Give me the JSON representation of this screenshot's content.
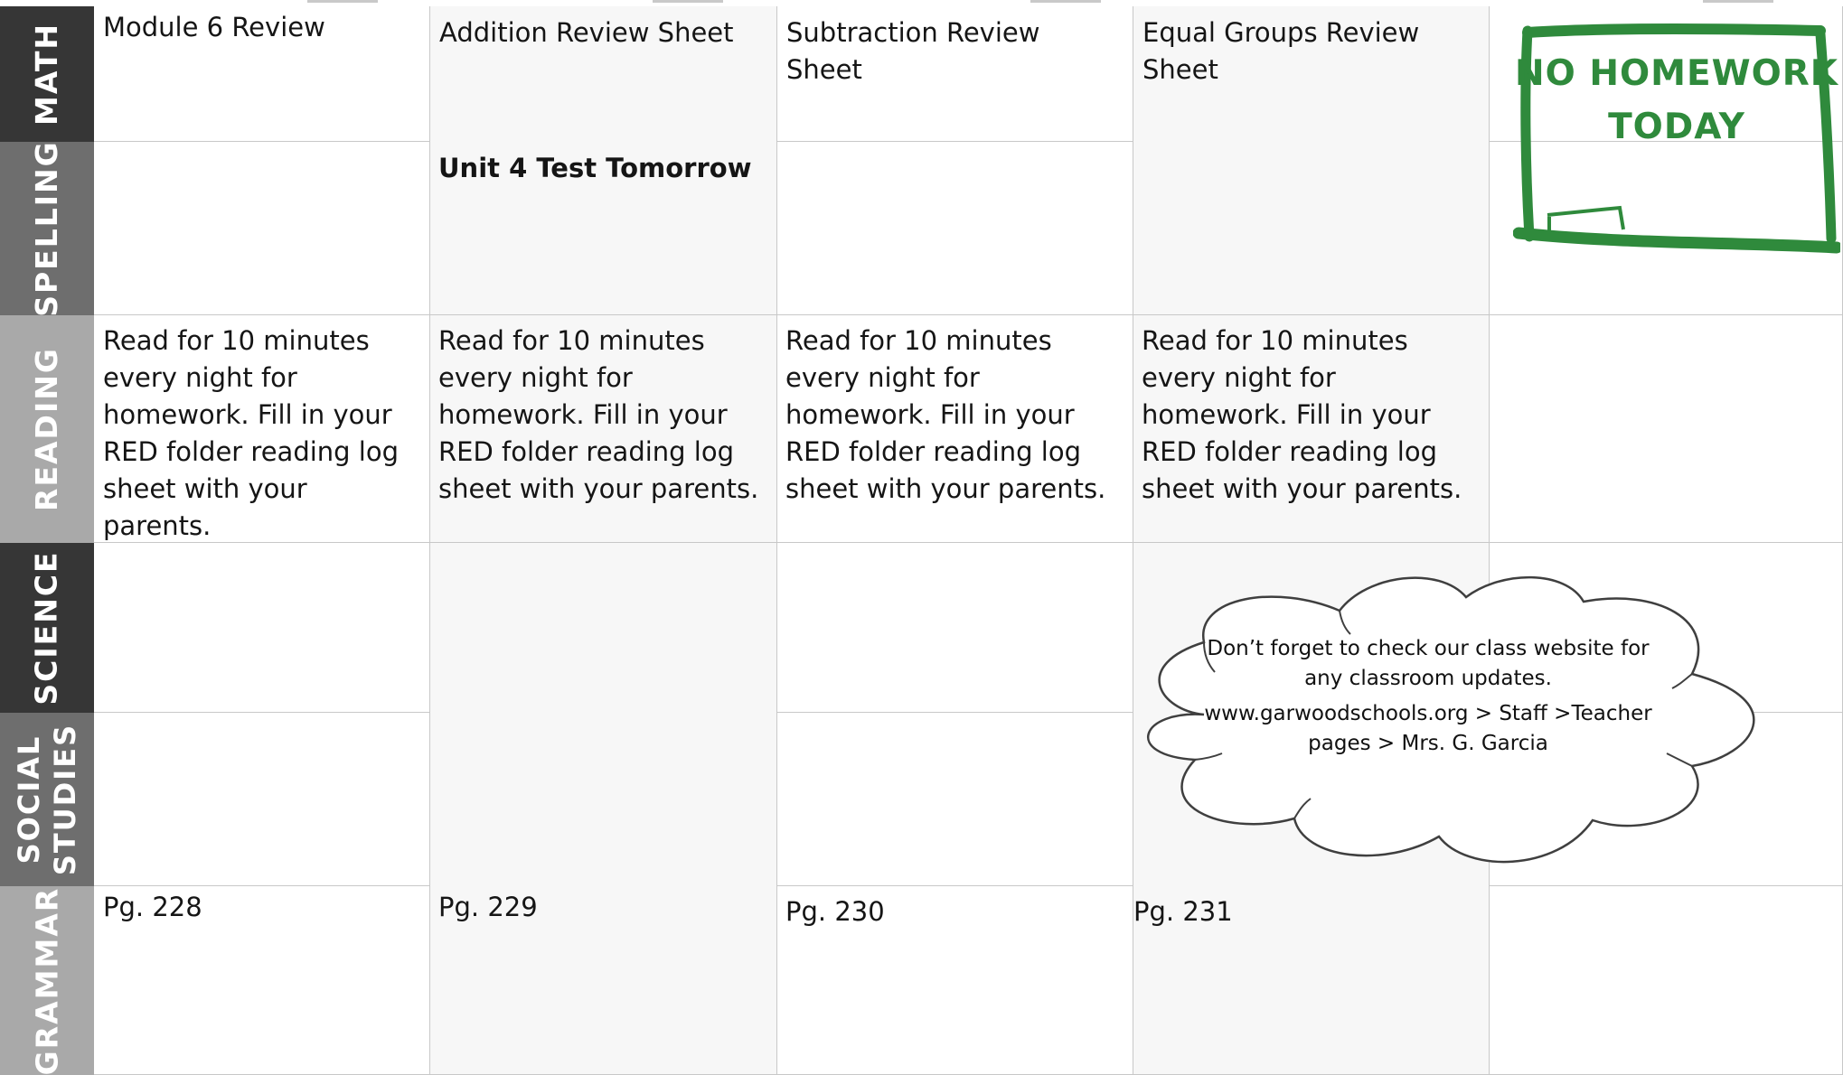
{
  "subjects": [
    "MATH",
    "SPELLING",
    "READING",
    "SCIENCE",
    "SOCIAL\nSTUDIES",
    "GRAMMAR"
  ],
  "math": {
    "day1": "Module 6  Review",
    "day2": "Addition Review Sheet",
    "day3": "Subtraction Review Sheet",
    "day4": "Equal Groups Review Sheet"
  },
  "spelling": {
    "day2": "Unit 4 Test Tomorrow"
  },
  "reading": {
    "day1": "Read for 10 minutes every night for homework.  Fill in your RED folder reading log sheet with your parents.",
    "day2": "Read for 10 minutes every night for homework.  Fill in your RED folder reading log sheet with your parents.",
    "day3": "Read for 10 minutes every night for homework.  Fill in your RED folder reading log sheet with your parents.",
    "day4": "Read for 10 minutes every night for homework.  Fill in your RED folder reading log sheet with your parents."
  },
  "grammar": {
    "day1": "Pg. 228",
    "day2": "Pg. 229",
    "day3": "Pg. 230",
    "day4": "Pg. 231"
  },
  "no_homework": "NO HOMEWORK TODAY",
  "cloud_note": {
    "line1": "Don’t forget to check our class website for any classroom updates.",
    "line2": "www.garwoodschools.org > Staff >Teacher pages > Mrs. G. Garcia"
  },
  "colors": {
    "side_dark": "#363636",
    "side_mid": "#6e6e6e",
    "side_light": "#a9a9a9",
    "stamp_green": "#2f8a3c"
  }
}
